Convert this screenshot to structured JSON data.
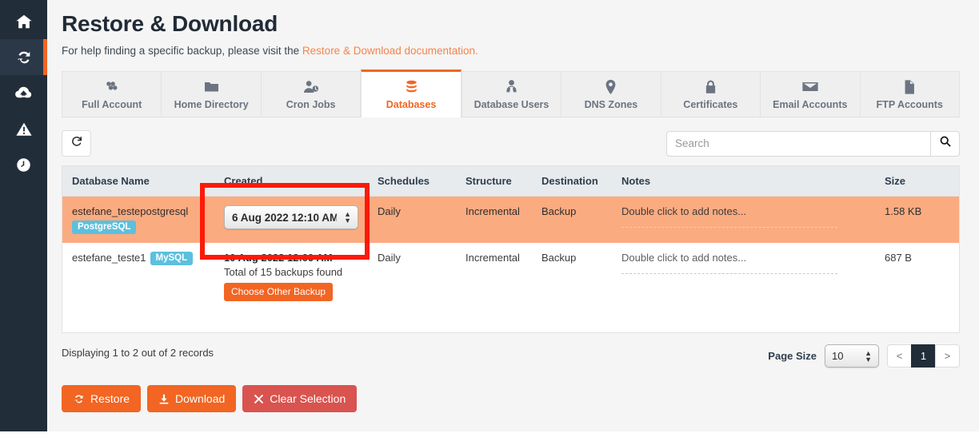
{
  "sidebar": {
    "items": [
      {
        "name": "home",
        "icon": "home-icon",
        "active": false
      },
      {
        "name": "restore",
        "icon": "sync-icon",
        "active": true
      },
      {
        "name": "backups",
        "icon": "cloud-download-icon",
        "active": false
      },
      {
        "name": "alerts",
        "icon": "warning-icon",
        "active": false
      },
      {
        "name": "history",
        "icon": "clock-icon",
        "active": false
      }
    ]
  },
  "header": {
    "title": "Restore & Download",
    "subtitle_prefix": "For help finding a specific backup, please visit the ",
    "subtitle_link": "Restore & Download documentation."
  },
  "tabs": [
    {
      "label": "Full Account",
      "icon": "cubes-icon",
      "active": false
    },
    {
      "label": "Home Directory",
      "icon": "folder-icon",
      "active": false
    },
    {
      "label": "Cron Jobs",
      "icon": "user-clock-icon",
      "active": false
    },
    {
      "label": "Databases",
      "icon": "database-icon",
      "active": true
    },
    {
      "label": "Database Users",
      "icon": "user-tie-icon",
      "active": false
    },
    {
      "label": "DNS Zones",
      "icon": "map-marker-icon",
      "active": false
    },
    {
      "label": "Certificates",
      "icon": "lock-icon",
      "active": false
    },
    {
      "label": "Email Accounts",
      "icon": "envelope-icon",
      "active": false
    },
    {
      "label": "FTP Accounts",
      "icon": "file-icon",
      "active": false
    }
  ],
  "toolbar": {
    "refresh_label": "",
    "search_placeholder": "Search",
    "search_value": ""
  },
  "table": {
    "columns": [
      "Database Name",
      "Created",
      "Schedules",
      "Structure",
      "Destination",
      "Notes",
      "Size"
    ],
    "rows": [
      {
        "db_name": "estefane_testepostgresql",
        "engine": "PostgreSQL",
        "engine_inline": false,
        "created_selected": "6 Aug 2022 12:10 AM",
        "created_is_select": true,
        "created_sub": "",
        "choose_other_label": "",
        "schedule": "Daily",
        "structure": "Incremental",
        "destination": "Backup",
        "notes": "Double click to add notes...",
        "size": "1.58 KB",
        "selected": true
      },
      {
        "db_name": "estefane_teste1",
        "engine": "MySQL",
        "engine_inline": true,
        "created_selected": "10 Aug 2022 12:09 AM",
        "created_is_select": false,
        "created_sub": "Total of 15 backups found",
        "choose_other_label": "Choose Other Backup",
        "schedule": "Daily",
        "structure": "Incremental",
        "destination": "Backup",
        "notes": "Double click to add notes...",
        "size": "687 B",
        "selected": false
      }
    ]
  },
  "footer": {
    "records_text": "Displaying 1 to 2 out of 2 records",
    "page_size_label": "Page Size",
    "page_size_value": "10",
    "prev_label": "<",
    "current_page": "1",
    "next_label": ">"
  },
  "actions": {
    "restore_label": "Restore",
    "download_label": "Download",
    "clear_label": "Clear Selection"
  },
  "colors": {
    "accent_orange": "#f26522",
    "sidebar_dark": "#222d3a",
    "selected_row": "#fbab80",
    "badge_blue": "#5bc0de",
    "danger_red": "#d9534f",
    "annotation_red": "#fc1a07"
  }
}
